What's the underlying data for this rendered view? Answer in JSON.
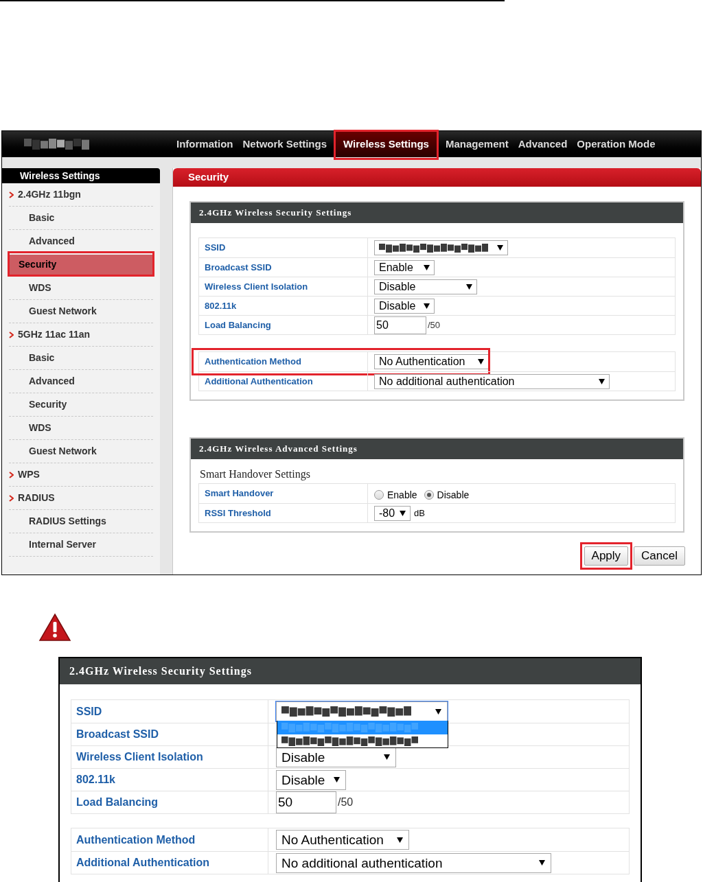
{
  "nav": {
    "items": [
      {
        "label": "Information",
        "selected": false,
        "highlighted": false
      },
      {
        "label": "Network Settings",
        "selected": false,
        "highlighted": false
      },
      {
        "label": "Wireless Settings",
        "selected": true,
        "highlighted": true
      },
      {
        "label": "Management",
        "selected": false,
        "highlighted": false
      },
      {
        "label": "Advanced",
        "selected": false,
        "highlighted": false
      },
      {
        "label": "Operation Mode",
        "selected": false,
        "highlighted": false
      }
    ]
  },
  "sidebar": {
    "title": "Wireless Settings",
    "groups": [
      {
        "label": "2.4GHz 11bgn",
        "children": [
          {
            "label": "Basic",
            "selected": false,
            "highlighted": false
          },
          {
            "label": "Advanced",
            "selected": false,
            "highlighted": false
          },
          {
            "label": "Security",
            "selected": true,
            "highlighted": true
          },
          {
            "label": "WDS",
            "selected": false,
            "highlighted": false
          },
          {
            "label": "Guest Network",
            "selected": false,
            "highlighted": false
          }
        ]
      },
      {
        "label": "5GHz 11ac 11an",
        "children": [
          {
            "label": "Basic",
            "selected": false,
            "highlighted": false
          },
          {
            "label": "Advanced",
            "selected": false,
            "highlighted": false
          },
          {
            "label": "Security",
            "selected": false,
            "highlighted": false
          },
          {
            "label": "WDS",
            "selected": false,
            "highlighted": false
          },
          {
            "label": "Guest Network",
            "selected": false,
            "highlighted": false
          }
        ]
      },
      {
        "label": "WPS"
      },
      {
        "label": "RADIUS",
        "children": [
          {
            "label": "RADIUS Settings",
            "selected": false,
            "highlighted": false
          },
          {
            "label": "Internal Server",
            "selected": false,
            "highlighted": false
          }
        ]
      }
    ]
  },
  "panel": {
    "title": "Security",
    "sections": [
      {
        "title": "2.4GHz Wireless Security Settings",
        "groups": [
          [
            {
              "label": "SSID",
              "kind": "redacted_select",
              "highlighted": false
            },
            {
              "label": "Broadcast SSID",
              "kind": "select",
              "value": "Enable",
              "highlighted": false
            },
            {
              "label": "Wireless Client Isolation",
              "kind": "select",
              "value": "Disable",
              "highlighted": false
            },
            {
              "label": "802.11k",
              "kind": "select",
              "value": "Disable",
              "highlighted": false
            },
            {
              "label": "Load Balancing",
              "kind": "input",
              "value": "50",
              "suffix": "/50",
              "highlighted": false
            }
          ],
          [
            {
              "label": "Authentication Method",
              "kind": "select",
              "value": "No Authentication",
              "highlighted": true
            },
            {
              "label": "Additional Authentication",
              "kind": "select",
              "value": "No additional authentication",
              "highlighted": false
            }
          ]
        ]
      },
      {
        "title": "2.4GHz Wireless Advanced Settings",
        "subtitle": "Smart Handover Settings",
        "groups": [
          [
            {
              "label": "Smart Handover",
              "kind": "radio",
              "options": [
                {
                  "label": "Enable",
                  "selected": false
                },
                {
                  "label": "Disable",
                  "selected": true
                }
              ],
              "highlighted": false
            },
            {
              "label": "RSSI Threshold",
              "kind": "select",
              "value": "-80",
              "suffix": "dB",
              "highlighted": false
            }
          ]
        ]
      }
    ],
    "buttons": [
      {
        "label": "Apply",
        "highlighted": true
      },
      {
        "label": "Cancel",
        "highlighted": false
      }
    ]
  },
  "detail": {
    "title": "2.4GHz Wireless Security Settings",
    "groups": [
      [
        {
          "label": "SSID",
          "kind": "redacted_select",
          "open": true,
          "options": [
            {
              "selected": true
            },
            {
              "selected": false
            }
          ]
        },
        {
          "label": "Broadcast SSID",
          "kind": "hidden"
        },
        {
          "label": "Wireless Client Isolation",
          "kind": "select",
          "value": "Disable"
        },
        {
          "label": "802.11k",
          "kind": "select",
          "value": "Disable"
        },
        {
          "label": "Load Balancing",
          "kind": "input",
          "value": "50",
          "suffix": "/50"
        }
      ],
      [
        {
          "label": "Authentication Method",
          "kind": "select",
          "value": "No Authentication"
        },
        {
          "label": "Additional Authentication",
          "kind": "select",
          "value": "No additional authentication"
        }
      ]
    ]
  }
}
